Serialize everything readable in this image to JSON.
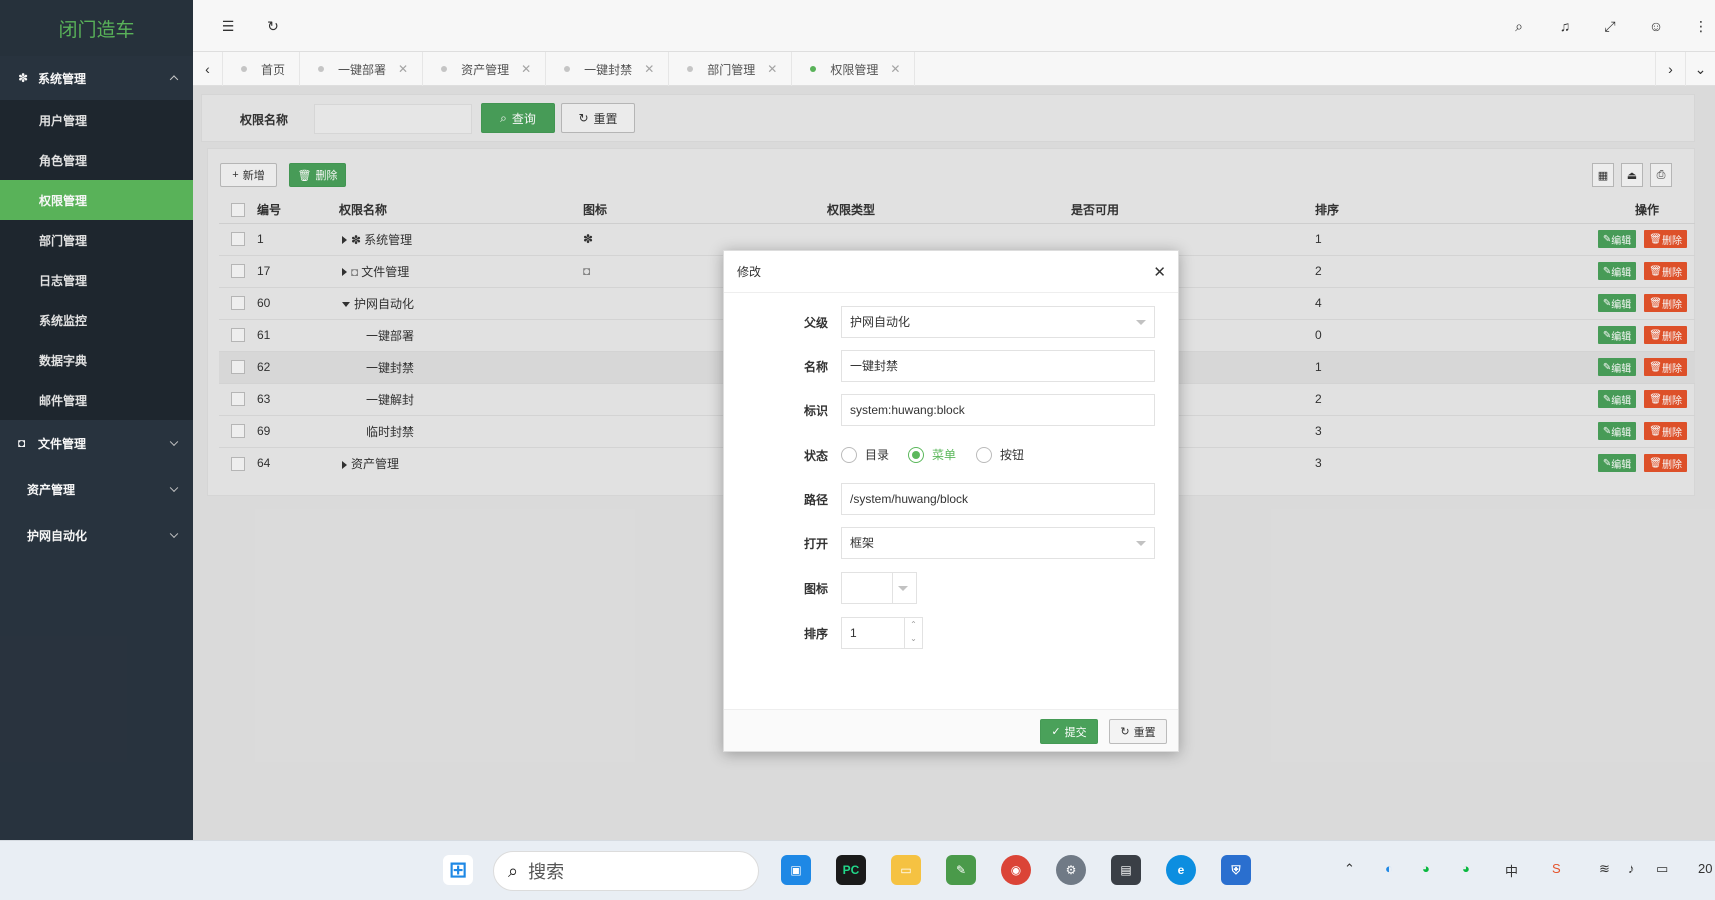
{
  "app": {
    "logo": "闭门造车"
  },
  "sidebar": {
    "system": {
      "label": "系统管理",
      "icon": "gear-icon"
    },
    "system_items": [
      "用户管理",
      "角色管理",
      "权限管理",
      "部门管理",
      "日志管理",
      "系统监控",
      "数据字典",
      "邮件管理"
    ],
    "active_item": "权限管理",
    "file": {
      "label": "文件管理",
      "icon": "camera-icon"
    },
    "asset": {
      "label": "资产管理"
    },
    "auto": {
      "label": "护网自动化"
    }
  },
  "tabs": [
    {
      "label": "首页",
      "closable": false
    },
    {
      "label": "一键部署",
      "closable": true
    },
    {
      "label": "资产管理",
      "closable": true
    },
    {
      "label": "一键封禁",
      "closable": true
    },
    {
      "label": "部门管理",
      "closable": true
    },
    {
      "label": "权限管理",
      "closable": true,
      "active": true
    }
  ],
  "search": {
    "label": "权限名称",
    "query_btn": "查询",
    "reset_btn": "重置"
  },
  "toolbar": {
    "add_btn": "新增",
    "delete_btn": "删除"
  },
  "table": {
    "headers": [
      "编号",
      "权限名称",
      "图标",
      "权限类型",
      "是否可用",
      "排序",
      "操作"
    ],
    "rows": [
      {
        "id": "1",
        "name": "系统管理",
        "icon": "gear-icon",
        "expand": "right",
        "sort": "1"
      },
      {
        "id": "17",
        "name": "文件管理",
        "icon": "camera-icon",
        "expand": "right",
        "sort": "2"
      },
      {
        "id": "60",
        "name": "护网自动化",
        "icon": "",
        "expand": "down",
        "sort": "4"
      },
      {
        "id": "61",
        "name": "一键部署",
        "icon": "",
        "expand": "",
        "sort": "0"
      },
      {
        "id": "62",
        "name": "一键封禁",
        "icon": "",
        "expand": "",
        "sort": "1"
      },
      {
        "id": "63",
        "name": "一键解封",
        "icon": "",
        "expand": "",
        "sort": "2"
      },
      {
        "id": "69",
        "name": "临时封禁",
        "icon": "",
        "expand": "",
        "sort": "3"
      },
      {
        "id": "64",
        "name": "资产管理",
        "icon": "",
        "expand": "right",
        "sort": "3"
      }
    ],
    "edit_label": "编辑",
    "delete_label": "删除"
  },
  "modal": {
    "title": "修改",
    "parent_label": "父级",
    "parent_value": "护网自动化",
    "name_label": "名称",
    "name_value": "一键封禁",
    "tag_label": "标识",
    "tag_value": "system:huwang:block",
    "status_label": "状态",
    "status_options": [
      "目录",
      "菜单",
      "按钮"
    ],
    "status_selected": "菜单",
    "path_label": "路径",
    "path_value": "/system/huwang/block",
    "open_label": "打开",
    "open_value": "框架",
    "icon_label": "图标",
    "sort_label": "排序",
    "sort_value": "1",
    "submit_btn": "提交",
    "reset_btn": "重置"
  },
  "taskbar": {
    "search_placeholder": "搜索",
    "lang": "中",
    "clock_partial": "20"
  },
  "colors": {
    "accent": "#5cb85c",
    "sidebar_bg": "#2a3540",
    "danger": "#e5532b"
  }
}
